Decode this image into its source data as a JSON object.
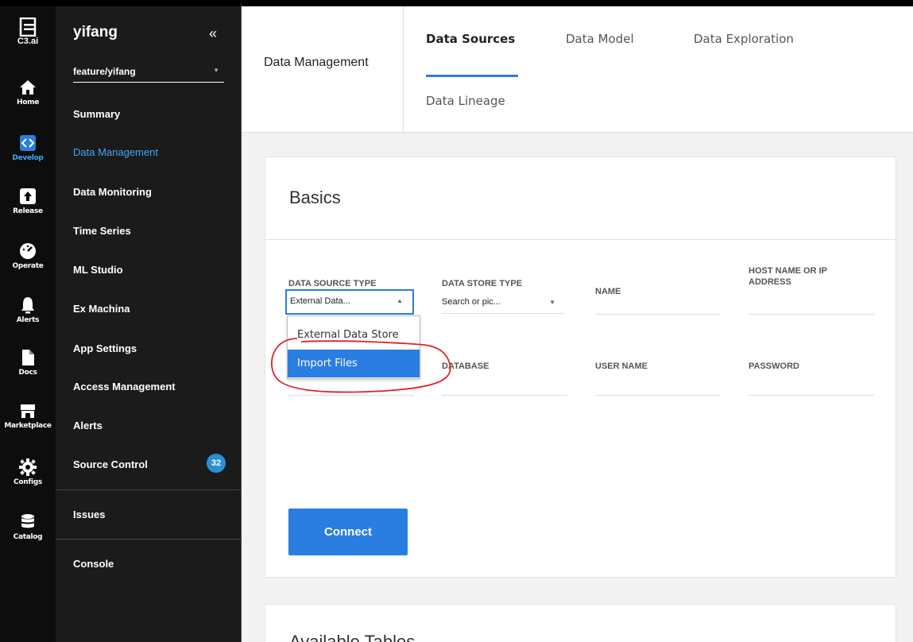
{
  "rail": {
    "brand": "C3.ai",
    "items": [
      {
        "label": "Home",
        "icon": "home-icon"
      },
      {
        "label": "Develop",
        "icon": "code-icon"
      },
      {
        "label": "Release",
        "icon": "upload-icon"
      },
      {
        "label": "Operate",
        "icon": "gauge-icon"
      },
      {
        "label": "Alerts",
        "icon": "bell-icon"
      },
      {
        "label": "Docs",
        "icon": "document-icon"
      },
      {
        "label": "Marketplace",
        "icon": "store-icon"
      },
      {
        "label": "Configs",
        "icon": "gear-icon"
      },
      {
        "label": "Catalog",
        "icon": "database-icon"
      }
    ],
    "active_color": "#3fa9f5"
  },
  "sidebar": {
    "project": "yifang",
    "collapse_glyph": "«",
    "branch": "feature/yifang",
    "items": [
      {
        "label": "Summary"
      },
      {
        "label": "Data Management"
      },
      {
        "label": "Data Monitoring"
      },
      {
        "label": "Time Series"
      },
      {
        "label": "ML Studio"
      },
      {
        "label": "Ex Machina"
      },
      {
        "label": "App Settings"
      },
      {
        "label": "Access Management"
      },
      {
        "label": "Alerts"
      },
      {
        "label": "Source Control"
      },
      {
        "label": "Issues"
      },
      {
        "label": "Console"
      }
    ],
    "source_control_badge": "32"
  },
  "header": {
    "section_title": "Data Management",
    "tabs": [
      {
        "label": "Data Sources"
      },
      {
        "label": "Data Model"
      },
      {
        "label": "Data Exploration"
      },
      {
        "label": "Data Lineage"
      }
    ],
    "accent": "#2a7de1"
  },
  "basics": {
    "title": "Basics",
    "fields": {
      "data_source_type": {
        "label": "DATA SOURCE TYPE",
        "value": "External Data..."
      },
      "data_store_type": {
        "label": "DATA STORE TYPE",
        "value": "Search or pic..."
      },
      "name": {
        "label": "NAME"
      },
      "host": {
        "label": "HOST NAME OR IP ADDRESS"
      },
      "database": {
        "label": "DATABASE"
      },
      "user_name": {
        "label": "USER NAME"
      },
      "password": {
        "label": "PASSWORD"
      }
    },
    "dropdown_options": [
      {
        "label": "External Data Store"
      },
      {
        "label": "Import Files"
      }
    ],
    "connect_label": "Connect"
  },
  "available_tables": {
    "title": "Available Tables"
  }
}
